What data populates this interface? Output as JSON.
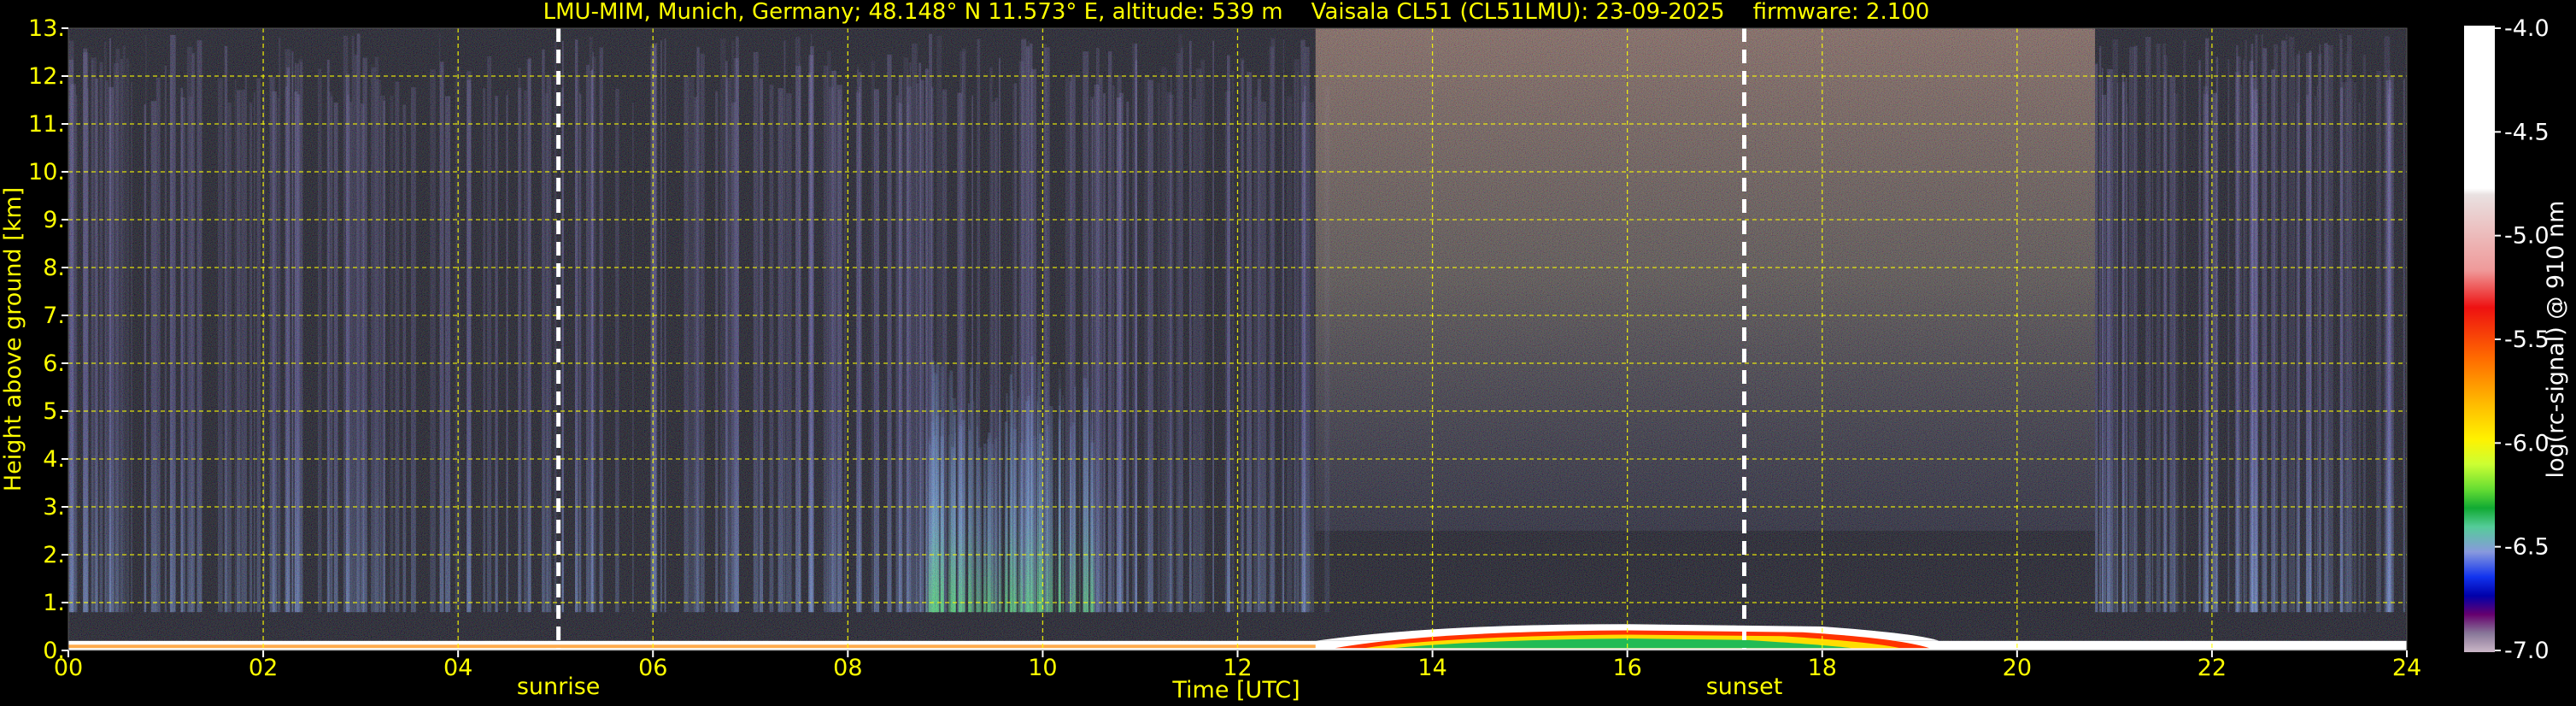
{
  "chart_data": {
    "type": "heatmap",
    "title": "LMU-MIM, Munich, Germany; 48.148° N 11.573° E, altitude: 539 m    Vaisala CL51 (CL51LMU): 23-09-2025    firmware: 2.100",
    "xlabel": "Time [UTC]",
    "ylabel": "Height above ground [km]",
    "xlim": [
      0,
      24
    ],
    "ylim": [
      0,
      13
    ],
    "x_ticks": [
      "00",
      "02",
      "04",
      "06",
      "08",
      "10",
      "12",
      "14",
      "16",
      "18",
      "20",
      "22",
      "24"
    ],
    "y_ticks": [
      "0.",
      "1.",
      "2.",
      "3.",
      "4.",
      "5.",
      "6.",
      "7.",
      "8.",
      "9.",
      "10.",
      "11.",
      "12.",
      "13."
    ],
    "grid": true,
    "markers": [
      {
        "label": "sunrise",
        "time": 5.03
      },
      {
        "label": "sunset",
        "time": 17.2
      }
    ],
    "colorbar": {
      "label": "log(rc-signal) @ 910 nm",
      "range": [
        -7.0,
        -4.0
      ],
      "ticks": [
        "-4.0",
        "-4.5",
        "-5.0",
        "-5.5",
        "-6.0",
        "-6.5",
        "-7.0"
      ]
    },
    "features": [
      {
        "description": "surface boundary layer",
        "from": 0,
        "to": 24,
        "top_km": 0.2
      },
      {
        "description": "convective boundary layer",
        "from": 12.8,
        "to": 19.2,
        "top_km": 0.45
      },
      {
        "description": "enhanced aerosol column",
        "from": 8.8,
        "to": 10.5,
        "top_km": 5.0
      }
    ]
  },
  "colors": {
    "text": "#ffff00",
    "grid": "#ffff00",
    "background": "#000000",
    "marker": "#ffffff",
    "colorbar_scale": [
      "#ffffff",
      "#e9e1e1",
      "#ef9a9a",
      "#ee1111",
      "#ff6a00",
      "#ffb700",
      "#fff200",
      "#ccff33",
      "#66dd33",
      "#11aa33",
      "#55cc99",
      "#8899dd",
      "#1133ee",
      "#0000aa",
      "#66006e",
      "#887799",
      "#cbb7c7"
    ]
  }
}
